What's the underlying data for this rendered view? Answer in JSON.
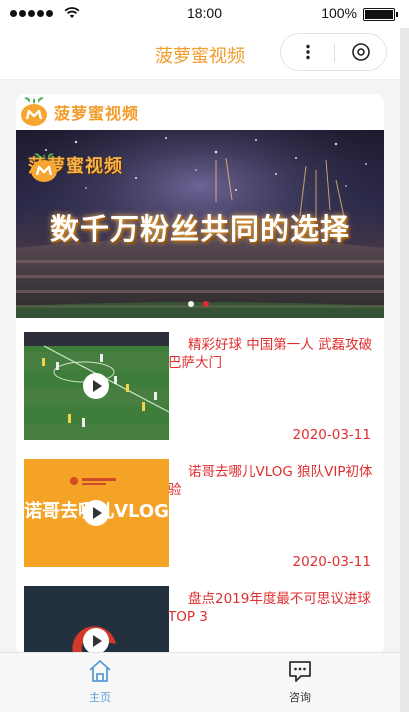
{
  "status_bar": {
    "time": "18:00",
    "battery_percent": "100%"
  },
  "nav_bar": {
    "title": "菠萝蜜视频",
    "more_icon": "more-icon",
    "close_icon": "close-circle-icon"
  },
  "brand": {
    "name": "菠萝蜜视频",
    "logo_icon": "pineapple-logo-icon"
  },
  "banner": {
    "brand_name": "菠萝蜜视频",
    "slogan": "数千万粉丝共同的选择",
    "indicator_count": 2,
    "active_index": 1,
    "colors": {
      "active": "#e02e2e",
      "inactive": "#ffffff"
    }
  },
  "videos": [
    {
      "title": "精彩好球 中国第一人 武磊攻破巴萨大门",
      "date": "2020-03-11"
    },
    {
      "title": "诺哥去哪儿VLOG 狼队VIP初体验",
      "date": "2020-03-11",
      "thumb_text": "诺哥去哪儿VLOG"
    },
    {
      "title": "盘点2019年度最不可思议进球TOP 3",
      "date": ""
    }
  ],
  "tabs": [
    {
      "label": "主页",
      "icon": "home-icon",
      "active": true
    },
    {
      "label": "咨询",
      "icon": "chat-icon",
      "active": false
    }
  ],
  "colors": {
    "accent": "#f29c2b",
    "title_red": "#e02e2e",
    "tab_active": "#5b9bd5",
    "tab_inactive": "#333333"
  }
}
